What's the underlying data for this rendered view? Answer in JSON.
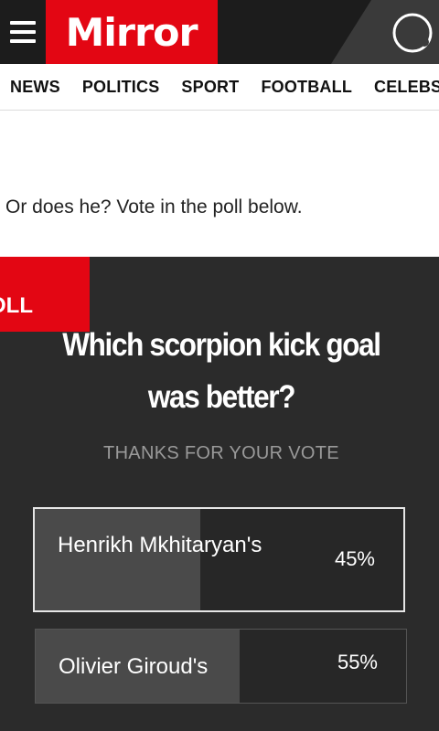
{
  "header": {
    "logo": "Mirror"
  },
  "nav": [
    "NEWS",
    "POLITICS",
    "SPORT",
    "FOOTBALL",
    "CELEBS"
  ],
  "article": {
    "text": "Or does he? Vote in the poll below."
  },
  "poll": {
    "tag": "POLL",
    "question": "Which scorpion kick goal was better?",
    "thanks": "THANKS FOR YOUR VOTE",
    "options": [
      {
        "label": "Henrikh Mkhitaryan's",
        "percent": "45%",
        "share": 45,
        "selected": true
      },
      {
        "label": "Olivier Giroud's",
        "percent": "55%",
        "share": 55,
        "selected": false
      }
    ]
  },
  "colors": {
    "brand_red": "#e30613",
    "poll_bg": "#2b2b2b",
    "bar_fill": "#4a4a4a"
  }
}
